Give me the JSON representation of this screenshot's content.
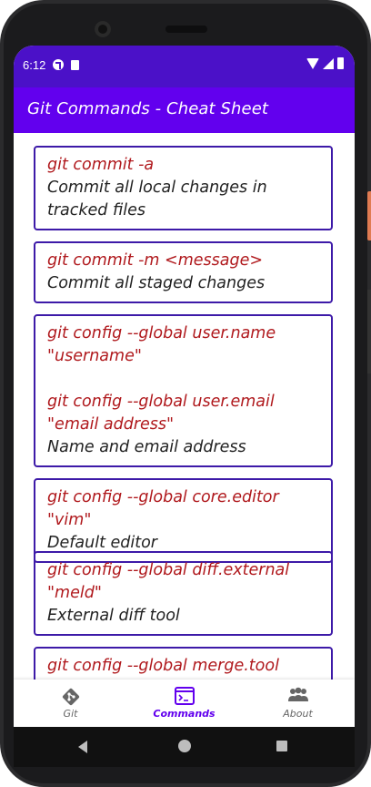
{
  "status": {
    "time": "6:12"
  },
  "app": {
    "title": "Git Commands - Cheat Sheet"
  },
  "cards": [
    {
      "command": "git commit -a",
      "description": "Commit all local changes in tracked files"
    },
    {
      "command": "git commit -m <message>",
      "description": "Commit all staged changes"
    },
    {
      "command": "git config --global user.name \"username\"\n\ngit config --global user.email \"email address\"",
      "description": "Name and email address"
    },
    {
      "command": "git config --global core.editor \"vim\"",
      "description": "Default editor"
    },
    {
      "command": "git config --global diff.external \"meld\"",
      "description": "External diff tool"
    },
    {
      "command": "git config --global merge.tool \"meld\"",
      "description": ""
    }
  ],
  "nav": {
    "git_label": "Git",
    "commands_label": "Commands",
    "about_label": "About"
  },
  "colors": {
    "status_bar": "#4b11c8",
    "app_bar": "#6200ee",
    "card_border": "#3d1aa8",
    "command_text": "#b0191d"
  },
  "icons": [
    "git-icon",
    "terminal-icon",
    "people-icon"
  ]
}
